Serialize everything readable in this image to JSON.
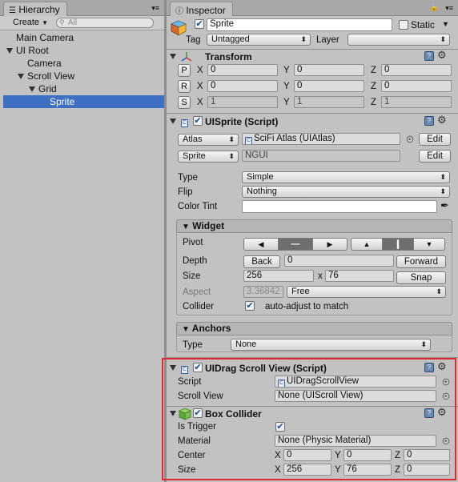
{
  "hierarchy": {
    "tab_label": "Hierarchy",
    "create_label": "Create",
    "search_placeholder": "All",
    "items": [
      {
        "label": "Main Camera"
      },
      {
        "label": "UI Root"
      },
      {
        "label": "Camera"
      },
      {
        "label": "Scroll View"
      },
      {
        "label": "Grid"
      },
      {
        "label": "Sprite"
      }
    ]
  },
  "inspector": {
    "tab_label": "Inspector",
    "object_name": "Sprite",
    "static_label": "Static",
    "tag_label": "Tag",
    "tag_value": "Untagged",
    "layer_label": "Layer",
    "layer_value": "",
    "transform": {
      "title": "Transform",
      "rows": [
        {
          "btn": "P",
          "x": "0",
          "y": "0",
          "z": "0"
        },
        {
          "btn": "R",
          "x": "0",
          "y": "0",
          "z": "0"
        },
        {
          "btn": "S",
          "x": "1",
          "y": "1",
          "z": "1"
        }
      ],
      "x_label": "X",
      "y_label": "Y",
      "z_label": "Z"
    },
    "uisprite": {
      "title": "UISprite (Script)",
      "atlas_btn": "Atlas",
      "atlas_value": "SciFi Atlas (UIAtlas)",
      "edit_label": "Edit",
      "sprite_btn": "Sprite",
      "sprite_value": "NGUI",
      "type_label": "Type",
      "type_value": "Simple",
      "flip_label": "Flip",
      "flip_value": "Nothing",
      "color_tint_label": "Color Tint",
      "widget": {
        "title": "Widget",
        "pivot_label": "Pivot",
        "depth_label": "Depth",
        "back_label": "Back",
        "depth_value": "0",
        "forward_label": "Forward",
        "size_label": "Size",
        "width": "256",
        "x_sep": "x",
        "height": "76",
        "snap_label": "Snap",
        "aspect_label": "Aspect",
        "aspect_value": "3.36842",
        "aspect_mode": "Free",
        "collider_label": "Collider",
        "collider_text": "auto-adjust to match"
      },
      "anchors": {
        "title": "Anchors",
        "type_label": "Type",
        "type_value": "None"
      }
    },
    "dragscroll": {
      "title": "UIDrag Scroll View (Script)",
      "script_label": "Script",
      "script_value": "UIDragScrollView",
      "scrollview_label": "Scroll View",
      "scrollview_value": "None (UIScroll View)"
    },
    "boxcollider": {
      "title": "Box Collider",
      "trigger_label": "Is Trigger",
      "material_label": "Material",
      "material_value": "None (Physic Material)",
      "center_label": "Center",
      "center": {
        "x": "0",
        "y": "0",
        "z": "0"
      },
      "size_label": "Size",
      "size": {
        "x": "256",
        "y": "76",
        "z": "0"
      },
      "x_label": "X",
      "y_label": "Y",
      "z_label": "Z"
    }
  },
  "colors": {
    "selection": "#3d6fc2",
    "highlight_border": "#e0282e"
  }
}
